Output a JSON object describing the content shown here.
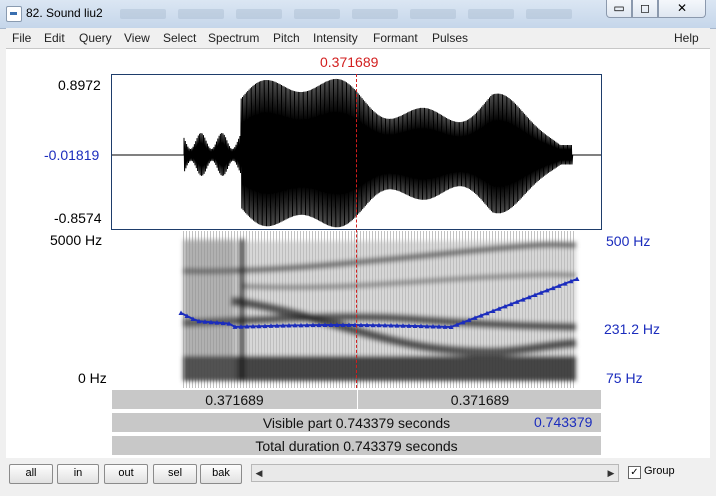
{
  "window": {
    "title": "82. Sound liu2",
    "minimize": "▭",
    "maximize": "◻",
    "close": "✕"
  },
  "menu": [
    "File",
    "Edit",
    "Query",
    "View",
    "Select",
    "Spectrum",
    "Pitch",
    "Intensity",
    "Formant",
    "Pulses"
  ],
  "help": "Help",
  "cursor_time": "0.371689",
  "waveform": {
    "max": "0.8972",
    "zero": "-0.01819",
    "min": "-0.8574"
  },
  "spectrogram": {
    "freq_top": "5000 Hz",
    "freq_bottom": "0 Hz"
  },
  "pitch_axis": {
    "top": "500 Hz",
    "mid": "231.2 Hz",
    "bottom": "75 Hz",
    "color": "#1b2cbd"
  },
  "bars": {
    "left_part": "0.371689",
    "right_part": "0.371689",
    "visible_start": "0",
    "visible_text": "Visible part 0.743379 seconds",
    "visible_end": "0.743379",
    "total_text": "Total duration 0.743379 seconds"
  },
  "buttons": {
    "all": "all",
    "in": "in",
    "out": "out",
    "sel": "sel",
    "bak": "bak"
  },
  "group": {
    "label": "Group",
    "checked": true
  },
  "accent_red": "#d21e1e"
}
